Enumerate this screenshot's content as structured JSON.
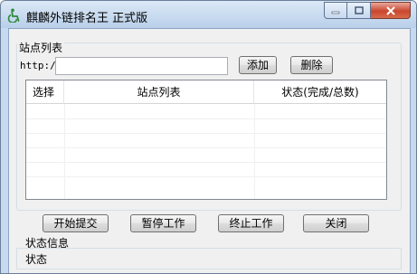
{
  "window": {
    "title": "麒麟外链排名王 正式版",
    "accent": "#c7d9ee",
    "close_color": "#c9462f",
    "icon": "wheelchair-icon"
  },
  "site_list_group": {
    "title": "站点列表",
    "url_label": "http://",
    "url_value": "",
    "add_label": "添加",
    "delete_label": "删除"
  },
  "table": {
    "columns": [
      "选择",
      "站点列表",
      "状态(完成/总数)"
    ],
    "rows": []
  },
  "actions": {
    "start_label": "开始提交",
    "pause_label": "暂停工作",
    "stop_label": "终止工作",
    "close_label": "关闭"
  },
  "status": {
    "group_title": "状态信息",
    "text": "状态"
  }
}
